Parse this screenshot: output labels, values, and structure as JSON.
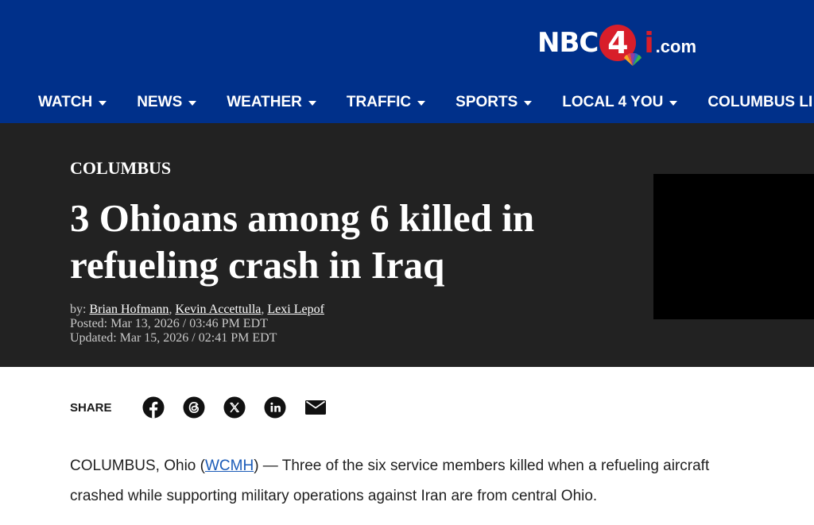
{
  "header": {
    "logo": {
      "nbc": "NBC",
      "four": "4",
      "i": "i",
      "com": ".com"
    },
    "nav": [
      {
        "label": "WATCH"
      },
      {
        "label": "NEWS"
      },
      {
        "label": "WEATHER"
      },
      {
        "label": "TRAFFIC"
      },
      {
        "label": "SPORTS"
      },
      {
        "label": "LOCAL 4 YOU"
      },
      {
        "label": "COLUMBUS LI"
      }
    ],
    "colors": {
      "navy": "#00308a",
      "logo_red": "#d81e2a"
    }
  },
  "article_header": {
    "section": "COLUMBUS",
    "headline": "3 Ohioans among 6 killed in refueling crash in Iraq",
    "byline": {
      "prefix": "by:",
      "authors": [
        "Brian Hofmann",
        "Kevin Accettulla",
        "Lexi Lepof"
      ],
      "separator": ","
    },
    "posted": "Posted: Mar 13, 2026 / 03:46 PM EDT",
    "updated": "Updated: Mar 15, 2026 / 02:41 PM EDT",
    "background": "#222222"
  },
  "share": {
    "label": "SHARE",
    "icons": [
      "facebook-icon",
      "threads-icon",
      "x-icon",
      "linkedin-icon",
      "email-icon"
    ]
  },
  "body": {
    "lead_before": "COLUMBUS, Ohio (",
    "source_link": "WCMH",
    "lead_after": ") — Three of the six service members killed when a refueling aircraft crashed while supporting military operations against Iran are from central Ohio.",
    "link_color": "#1a5bb8"
  }
}
